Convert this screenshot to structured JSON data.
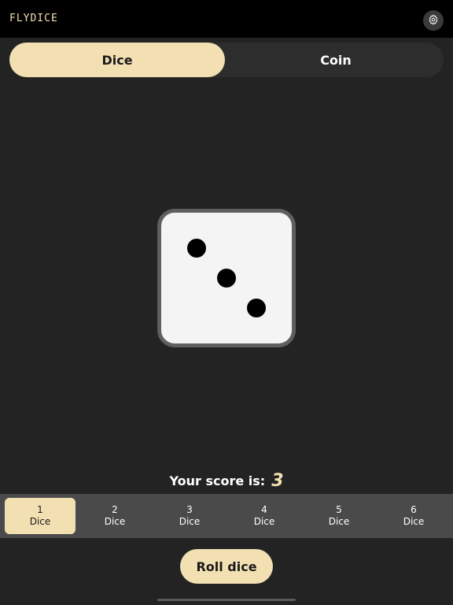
{
  "app": {
    "title": "FLYDICE",
    "settings_icon": "gear-icon"
  },
  "mode_tabs": [
    {
      "label": "Dice",
      "selected": true
    },
    {
      "label": "Coin",
      "selected": false
    }
  ],
  "die": {
    "face_value": 3
  },
  "score": {
    "label": "Your score is:",
    "value": "3"
  },
  "dice_count_options": [
    {
      "number": "1",
      "label": "Dice",
      "selected": true
    },
    {
      "number": "2",
      "label": "Dice",
      "selected": false
    },
    {
      "number": "3",
      "label": "Dice",
      "selected": false
    },
    {
      "number": "4",
      "label": "Dice",
      "selected": false
    },
    {
      "number": "5",
      "label": "Dice",
      "selected": false
    },
    {
      "number": "6",
      "label": "Dice",
      "selected": false
    }
  ],
  "roll_button": {
    "label": "Roll dice"
  },
  "colors": {
    "accent": "#f3e0b2",
    "background": "#232323",
    "topbar": "#000000",
    "count_bar": "#4a4a4a"
  }
}
